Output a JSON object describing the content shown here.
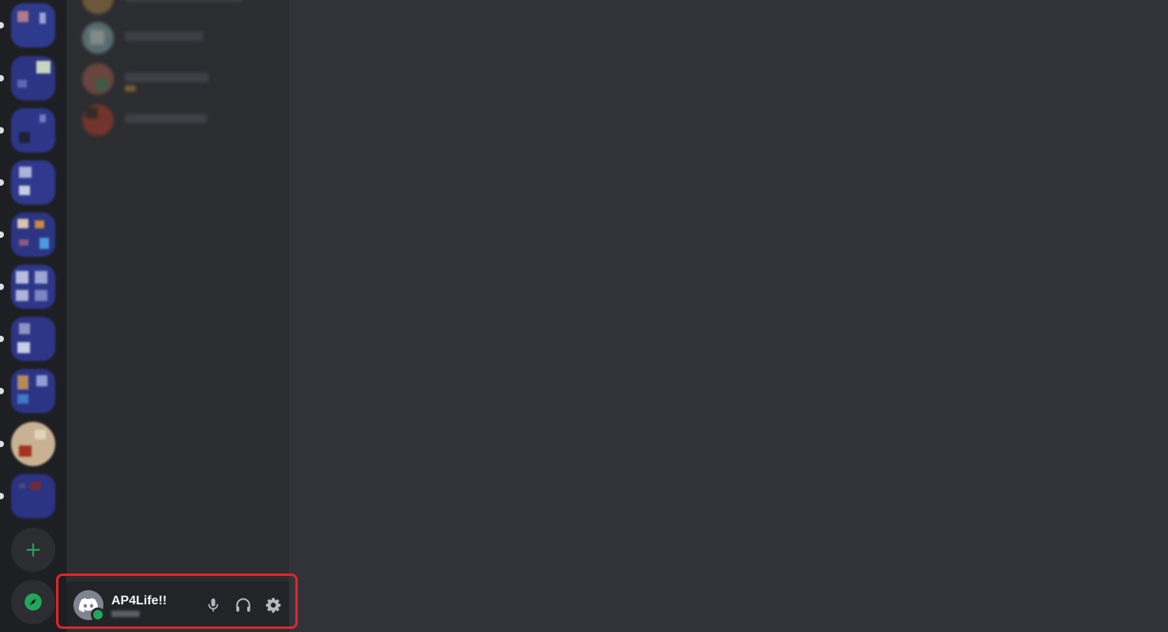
{
  "user_panel": {
    "username": "AP4Life!!",
    "status": "online",
    "actions": [
      {
        "name": "mute-microphone",
        "icon": "microphone-icon"
      },
      {
        "name": "deafen",
        "icon": "headphones-icon"
      },
      {
        "name": "user-settings",
        "icon": "gear-icon"
      }
    ]
  },
  "server_rail": {
    "add_server_icon": "plus-icon",
    "explore_icon": "compass-icon"
  },
  "colors": {
    "rail_bg": "#1e1f22",
    "list_bg": "#2b2d31",
    "main_bg": "#313338",
    "panel_bg": "#232428",
    "online": "#23a55a",
    "accent_green": "#23a55a",
    "highlight": "#e0262d"
  }
}
